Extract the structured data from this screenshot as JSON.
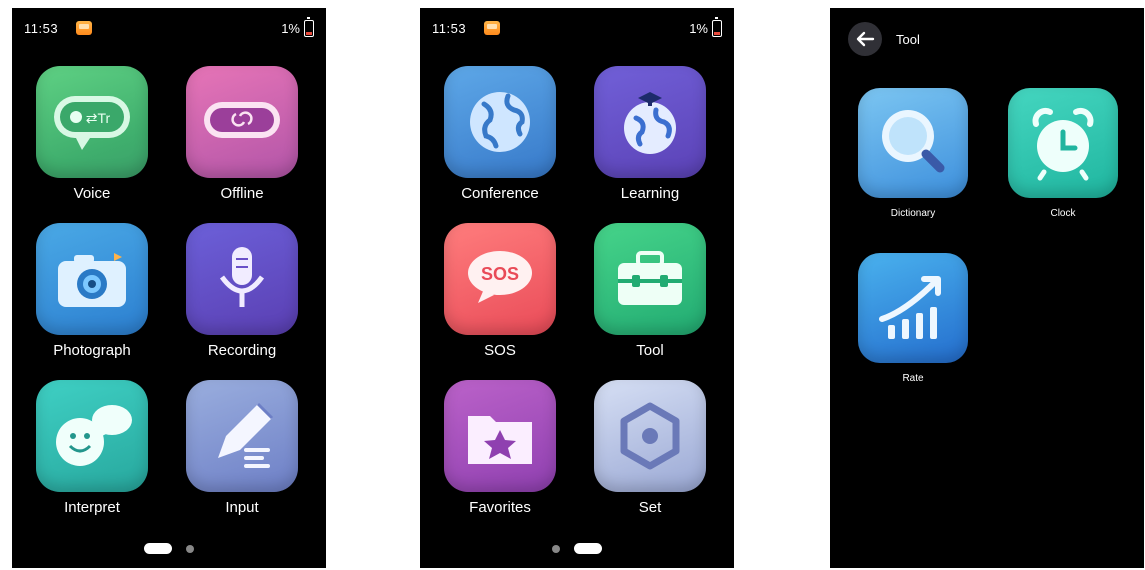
{
  "screen1": {
    "status": {
      "time": "11:53",
      "battery": "1%"
    },
    "apps": [
      {
        "label": "Voice",
        "icon": "voice-translate-icon"
      },
      {
        "label": "Offline",
        "icon": "offline-icon"
      },
      {
        "label": "Photograph",
        "icon": "camera-icon"
      },
      {
        "label": "Recording",
        "icon": "microphone-icon"
      },
      {
        "label": "Interpret",
        "icon": "interpret-icon"
      },
      {
        "label": "Input",
        "icon": "pencil-icon"
      }
    ],
    "page_indicator": {
      "current": 1,
      "total": 2
    }
  },
  "screen2": {
    "status": {
      "time": "11:53",
      "battery": "1%"
    },
    "apps": [
      {
        "label": "Conference",
        "icon": "globe-icon"
      },
      {
        "label": "Learning",
        "icon": "learning-globe-icon"
      },
      {
        "label": "SOS",
        "icon": "sos-icon"
      },
      {
        "label": "Tool",
        "icon": "toolbox-icon"
      },
      {
        "label": "Favorites",
        "icon": "star-folder-icon"
      },
      {
        "label": "Set",
        "icon": "settings-hexagon-icon"
      }
    ],
    "page_indicator": {
      "current": 2,
      "total": 2
    }
  },
  "screen3": {
    "header": {
      "title": "Tool",
      "back_icon": "back-arrow-icon"
    },
    "apps": [
      {
        "label": "Dictionary",
        "icon": "magnifier-icon"
      },
      {
        "label": "Clock",
        "icon": "alarm-clock-icon"
      },
      {
        "label": "Rate",
        "icon": "rate-chart-icon"
      }
    ]
  },
  "colors": {
    "background": "#000000",
    "text": "#ffffff",
    "indicator_inactive": "#888888"
  }
}
